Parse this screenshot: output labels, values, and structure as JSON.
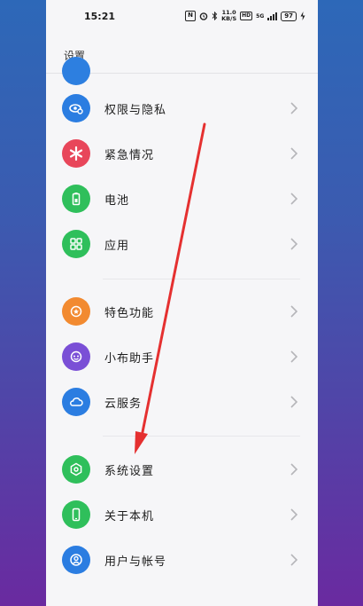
{
  "status": {
    "time": "15:21",
    "nfc": "N",
    "speed_top": "11.0",
    "speed_bottom": "KB/S",
    "hd": "HD",
    "network": "5G",
    "battery": "97"
  },
  "header": {
    "title": "设置"
  },
  "items": [
    {
      "label": "权限与隐私",
      "icon": "privacy-icon",
      "color": "#2b7de1"
    },
    {
      "label": "紧急情况",
      "icon": "emergency-icon",
      "color": "#e8465a"
    },
    {
      "label": "电池",
      "icon": "battery-icon",
      "color": "#2fbf5b"
    },
    {
      "label": "应用",
      "icon": "apps-icon",
      "color": "#2fbf5b"
    },
    {
      "label": "特色功能",
      "icon": "features-icon",
      "color": "#f28a30"
    },
    {
      "label": "小布助手",
      "icon": "assistant-icon",
      "color": "#7a4fd6"
    },
    {
      "label": "云服务",
      "icon": "cloud-icon",
      "color": "#2b7de1"
    },
    {
      "label": "系统设置",
      "icon": "system-settings-icon",
      "color": "#2fbf5b"
    },
    {
      "label": "关于本机",
      "icon": "phone-icon",
      "color": "#2fbf5b"
    },
    {
      "label": "用户与帐号",
      "icon": "user-icon",
      "color": "#2b7de1"
    }
  ]
}
